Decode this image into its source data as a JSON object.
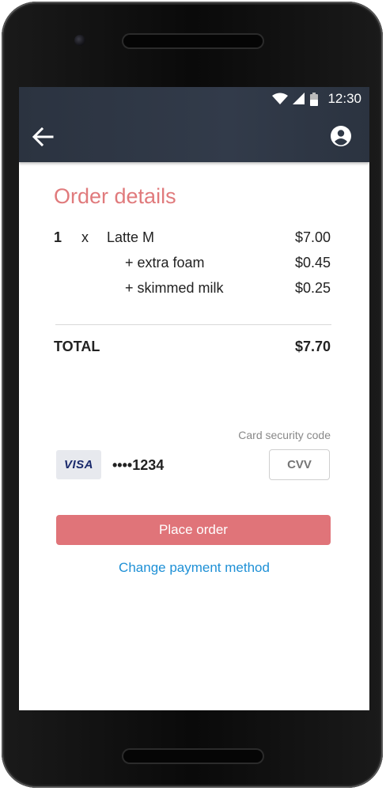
{
  "status_bar": {
    "time": "12:30"
  },
  "app_bar": {
    "back_icon": "arrow-back-icon",
    "account_icon": "account-circle-icon"
  },
  "order": {
    "title": "Order details",
    "line": {
      "qty": "1",
      "times": "x",
      "item": "Latte M",
      "price": "$7.00"
    },
    "addons": [
      {
        "name": "+ extra foam",
        "price": "$0.45"
      },
      {
        "name": "+ skimmed milk",
        "price": "$0.25"
      }
    ],
    "total_label": "TOTAL",
    "total_value": "$7.70"
  },
  "payment": {
    "card_brand": "VISA",
    "card_number": "••••1234",
    "security_label": "Card security code",
    "cvv_placeholder": "CVV"
  },
  "actions": {
    "place_order": "Place order",
    "change_payment": "Change payment method"
  },
  "colors": {
    "accent": "#e07479",
    "title": "#e07a7c",
    "link": "#1e90d6",
    "app_bar": "#2f3846"
  }
}
